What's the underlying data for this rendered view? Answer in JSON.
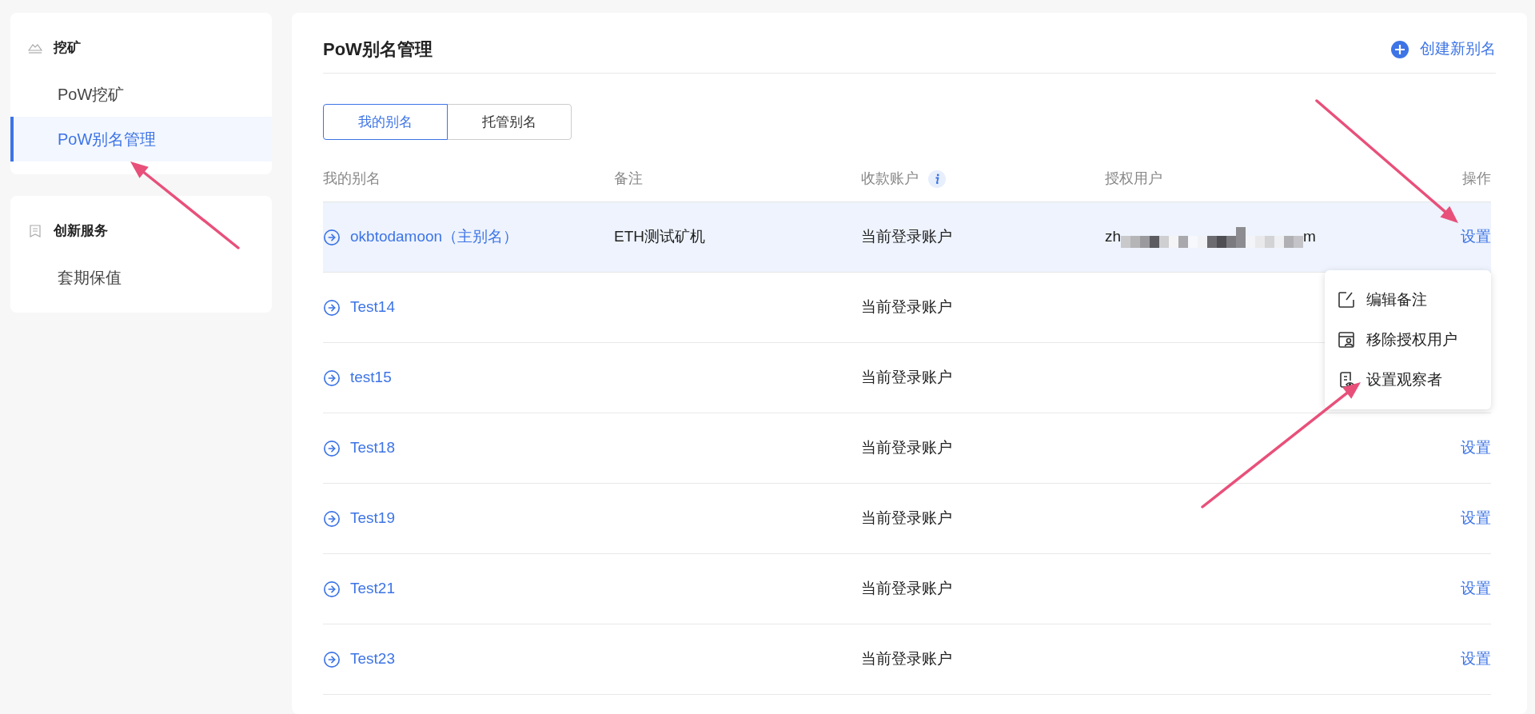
{
  "sidebar": [
    {
      "title": "挖矿",
      "kind": "mining",
      "items": [
        {
          "label": "PoW挖矿",
          "selected": false
        },
        {
          "label": "PoW别名管理",
          "selected": true
        }
      ]
    },
    {
      "title": "创新服务",
      "kind": "services",
      "items": [
        {
          "label": "套期保值",
          "selected": false
        }
      ]
    }
  ],
  "page": {
    "title": "PoW别名管理",
    "create_button": "创建新别名"
  },
  "tabs": [
    {
      "label": "我的别名",
      "selected": true
    },
    {
      "label": "托管别名",
      "selected": false
    }
  ],
  "table": {
    "columns": [
      {
        "label": "我的别名"
      },
      {
        "label": "备注"
      },
      {
        "label": "收款账户",
        "info": true
      },
      {
        "label": "授权用户"
      },
      {
        "label": "操作"
      }
    ],
    "rows": [
      {
        "alias": "okbtodamoon（主别名）",
        "remark": "ETH测试矿机",
        "account": "当前登录账户",
        "user_start": "zh",
        "user_end": "m",
        "action": "设置",
        "highlighted": true
      },
      {
        "alias": "Test14",
        "account": "当前登录账户",
        "highlighted": false
      },
      {
        "alias": "test15",
        "account": "当前登录账户",
        "highlighted": false
      },
      {
        "alias": "Test18",
        "account": "当前登录账户",
        "action": "设置",
        "highlighted": false
      },
      {
        "alias": "Test19",
        "account": "当前登录账户",
        "action": "设置",
        "highlighted": false
      },
      {
        "alias": "Test21",
        "account": "当前登录账户",
        "action": "设置",
        "highlighted": false
      },
      {
        "alias": "Test23",
        "account": "当前登录账户",
        "action": "设置",
        "highlighted": false
      }
    ]
  },
  "dropdown": [
    {
      "label": "编辑备注",
      "kind": "edit"
    },
    {
      "label": "移除授权用户",
      "kind": "remove-user"
    },
    {
      "label": "设置观察者",
      "kind": "observer"
    }
  ]
}
